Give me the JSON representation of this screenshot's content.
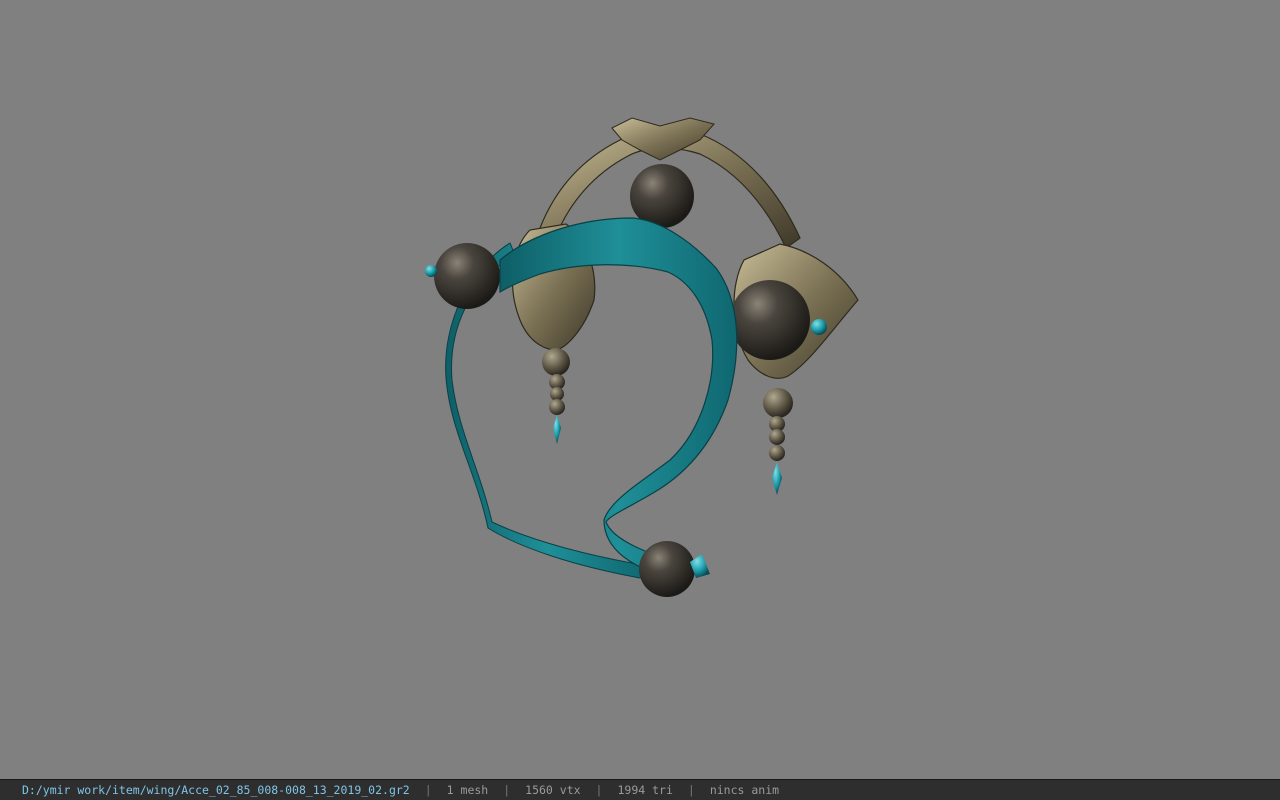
{
  "viewer": {
    "background_color": "#808080",
    "model_icon": "headpiece-model"
  },
  "statusbar": {
    "path": "D:/ymir work/item/wing/Acce_02_85_008-008_13_2019_02.gr2",
    "separator": "|",
    "mesh": "1 mesh",
    "vertices": "1560 vtx",
    "triangles": "1994 tri",
    "anim": "nincs anim",
    "path_color": "#7fc4e8"
  }
}
